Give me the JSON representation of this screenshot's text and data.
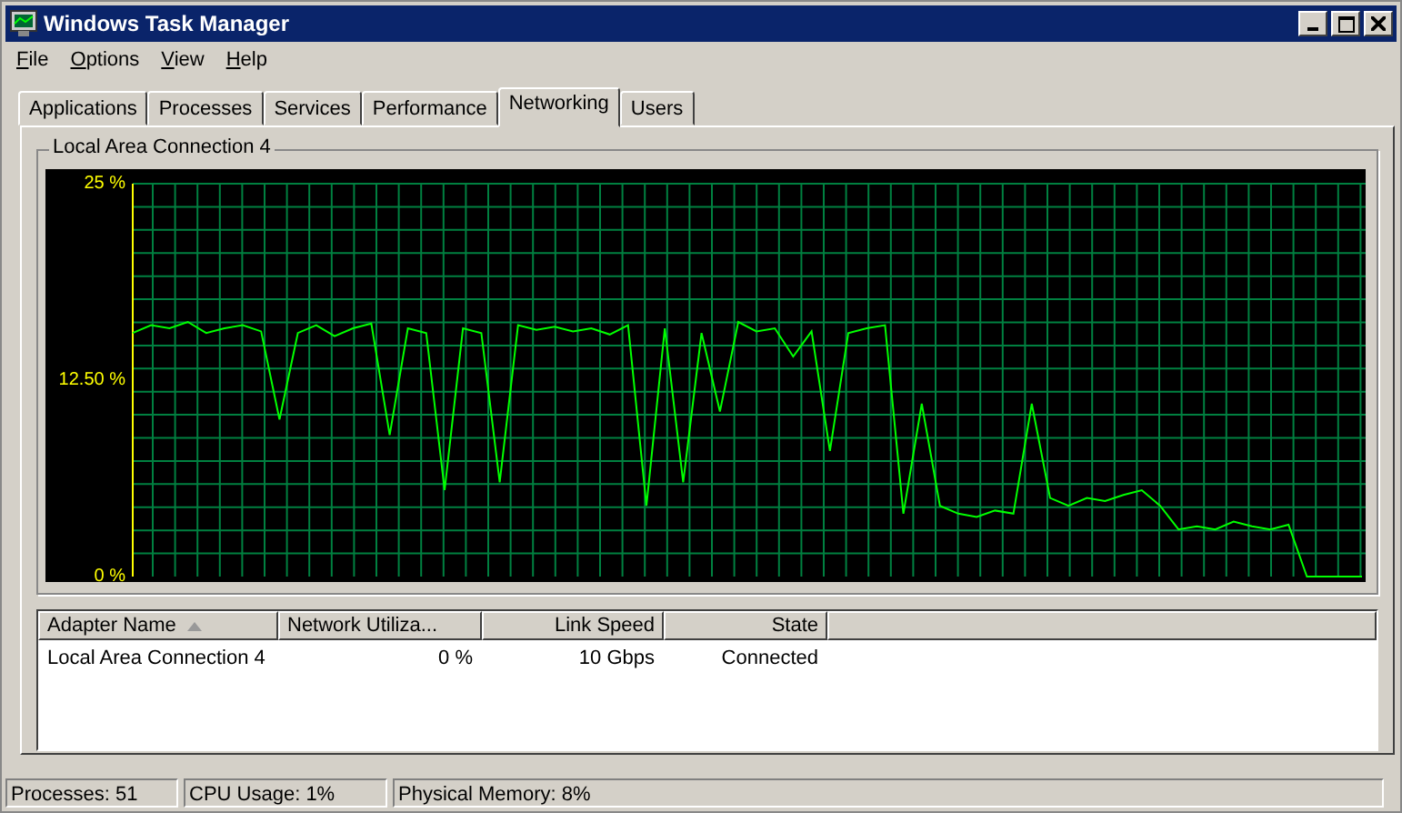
{
  "window": {
    "title": "Windows Task Manager"
  },
  "menu": [
    {
      "label": "File"
    },
    {
      "label": "Options"
    },
    {
      "label": "View"
    },
    {
      "label": "Help"
    }
  ],
  "tabs": [
    {
      "label": "Applications",
      "selected": false
    },
    {
      "label": "Processes",
      "selected": false
    },
    {
      "label": "Services",
      "selected": false
    },
    {
      "label": "Performance",
      "selected": false
    },
    {
      "label": "Networking",
      "selected": true
    },
    {
      "label": "Users",
      "selected": false
    }
  ],
  "graph_group": {
    "title": "Local Area Connection 4",
    "chart_data": {
      "type": "line",
      "grid": true,
      "ylim": [
        0,
        25
      ],
      "yticks": [
        {
          "value": 0,
          "label": "0 %"
        },
        {
          "value": 12.5,
          "label": "12.50 %"
        },
        {
          "value": 25,
          "label": "25 %"
        }
      ],
      "series": [
        {
          "color": "#00ff00",
          "values": [
            15.5,
            16,
            15.8,
            16.2,
            15.5,
            15.8,
            16,
            15.6,
            10,
            15.5,
            16,
            15.3,
            15.8,
            16.1,
            9,
            15.8,
            15.5,
            5.5,
            15.8,
            15.5,
            6,
            16,
            15.7,
            15.9,
            15.6,
            15.8,
            15.4,
            16,
            4.5,
            15.8,
            6,
            15.5,
            10.5,
            16.2,
            15.6,
            15.8,
            14,
            15.6,
            8,
            15.5,
            15.8,
            16,
            4,
            11,
            4.5,
            4,
            3.8,
            4.2,
            4,
            11,
            5,
            4.5,
            5,
            4.8,
            5.2,
            5.5,
            4.5,
            3,
            3.2,
            3,
            3.5,
            3.2,
            3,
            3.3,
            0,
            0,
            0,
            0
          ]
        }
      ]
    }
  },
  "table": {
    "columns": [
      {
        "label": "Adapter Name",
        "sorted": true
      },
      {
        "label": "Network Utiliza...",
        "sorted": false
      },
      {
        "label": "Link Speed",
        "sorted": false
      },
      {
        "label": "State",
        "sorted": false
      }
    ],
    "rows": [
      [
        "Local Area Connection 4",
        "0 %",
        "10 Gbps",
        "Connected"
      ]
    ]
  },
  "status_bar": [
    "Processes: 51",
    "CPU Usage: 1%",
    "Physical Memory: 8%"
  ]
}
